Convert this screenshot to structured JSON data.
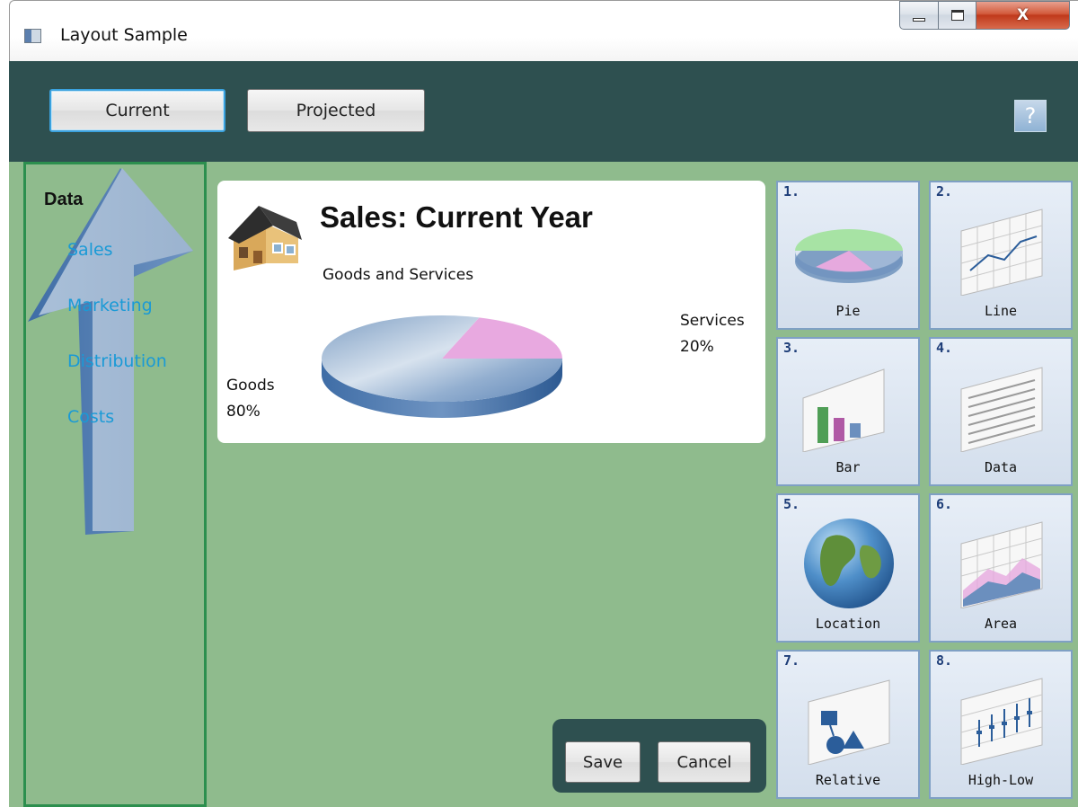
{
  "window": {
    "title": "Layout Sample",
    "controls": {
      "minimize": "minimize",
      "maximize": "maximize",
      "close": "X"
    }
  },
  "toolbar": {
    "tabs": [
      {
        "label": "Current",
        "selected": true
      },
      {
        "label": "Projected",
        "selected": false
      }
    ],
    "help_label": "?"
  },
  "sidebar": {
    "heading": "Data",
    "items": [
      {
        "label": "Sales"
      },
      {
        "label": "Marketing"
      },
      {
        "label": "Distribution"
      },
      {
        "label": "Costs"
      }
    ]
  },
  "chart_card": {
    "title": "Sales:  Current Year",
    "subtitle": "Goods and Services",
    "icon": "house-icon"
  },
  "chart_data": {
    "type": "pie",
    "title": "Sales:  Current Year",
    "subtitle": "Goods and Services",
    "slices": [
      {
        "label": "Goods",
        "value": 80,
        "value_label": "80%",
        "color": "#7f9fc4"
      },
      {
        "label": "Services",
        "value": 20,
        "value_label": "20%",
        "color": "#e8a9e0"
      }
    ]
  },
  "actions": {
    "save": "Save",
    "cancel": "Cancel"
  },
  "chart_types": [
    {
      "number": "1.",
      "label": "Pie",
      "icon": "pie-chart-icon"
    },
    {
      "number": "2.",
      "label": "Line",
      "icon": "line-chart-icon"
    },
    {
      "number": "3.",
      "label": "Bar",
      "icon": "bar-chart-icon"
    },
    {
      "number": "4.",
      "label": "Data",
      "icon": "data-sheet-icon"
    },
    {
      "number": "5.",
      "label": "Location",
      "icon": "globe-icon"
    },
    {
      "number": "6.",
      "label": "Area",
      "icon": "area-chart-icon"
    },
    {
      "number": "7.",
      "label": "Relative",
      "icon": "relative-shapes-icon"
    },
    {
      "number": "8.",
      "label": "High-Low",
      "icon": "high-low-chart-icon"
    }
  ],
  "colors": {
    "toolbar_bg": "#2e5050",
    "content_bg": "#8fbb8d",
    "sidebar_border": "#2c8f4e",
    "link": "#1a9ad6",
    "selected_tab_border": "#3ba2de",
    "tile_border": "#7fa0c4"
  }
}
